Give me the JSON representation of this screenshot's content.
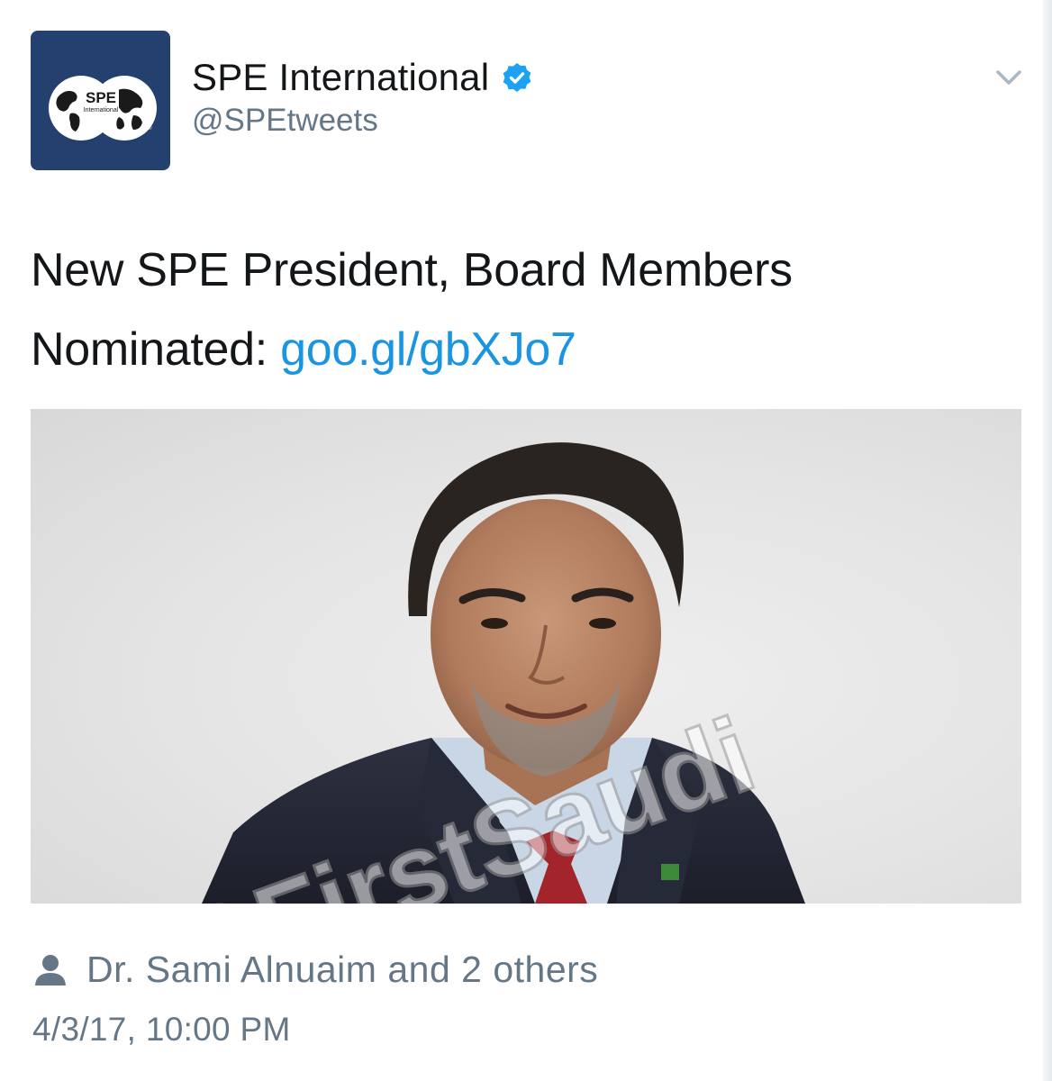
{
  "account": {
    "avatar_label": "SPE International",
    "avatar_sub": "International",
    "avatar_logo_text": "SPE",
    "display_name": "SPE International",
    "handle": "@SPEtweets",
    "verified": true,
    "avatar_color": "#23406e",
    "verified_color": "#1da1f2"
  },
  "menu": {
    "icon": "chevron-down-icon"
  },
  "tweet": {
    "text_before_link": "New SPE President, Board Members Nominated: ",
    "link": "goo.gl/gbXJo7",
    "link_color": "#1b95e0"
  },
  "media": {
    "watermark": "@FirstSaudi"
  },
  "tagged": {
    "icon": "person-icon",
    "label": "Dr. Sami Alnuaim and 2 others"
  },
  "timestamp": "4/3/17, 10:00 PM"
}
